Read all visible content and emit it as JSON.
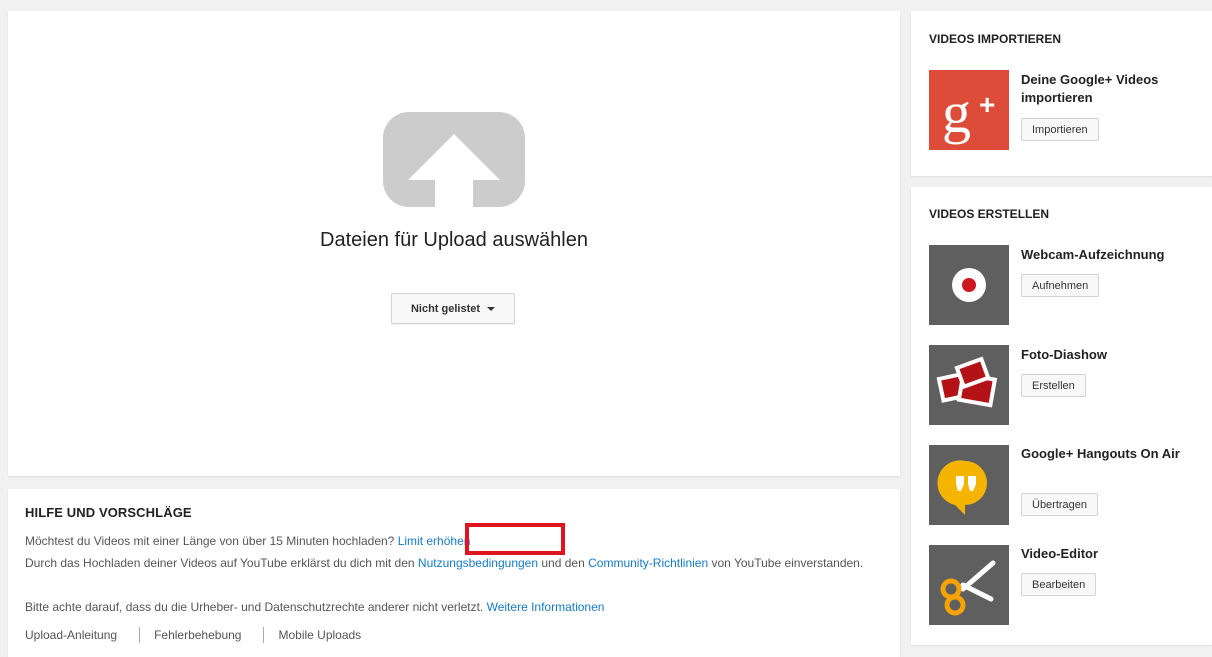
{
  "upload": {
    "title": "Dateien für Upload auswählen",
    "privacy_label": "Nicht gelistet"
  },
  "help": {
    "heading": "HILFE UND VORSCHLÄGE",
    "line1_text": "Möchtest du Videos mit einer Länge von über 15 Minuten hochladen?",
    "line1_link": "Limit erhöhen",
    "line2_prefix": "Durch das Hochladen deiner Videos auf YouTube erklärst du dich mit den",
    "line2_link1": "Nutzungsbedingungen",
    "line2_mid": "und den",
    "line2_link2": "Community-Richtlinien",
    "line2_suffix": "von YouTube einverstanden.",
    "line3_text": "Bitte achte darauf, dass du die Urheber- und Datenschutzrechte anderer nicht verletzt.",
    "line3_link": "Weitere Informationen",
    "links": [
      "Upload-Anleitung",
      "Fehlerbehebung",
      "Mobile Uploads"
    ]
  },
  "import_section": {
    "heading": "VIDEOS IMPORTIEREN",
    "item_title": "Deine Google+ Videos importieren",
    "button": "Importieren",
    "icon": "google-plus-icon"
  },
  "create_section": {
    "heading": "VIDEOS ERSTELLEN",
    "items": [
      {
        "title": "Webcam-Aufzeichnung",
        "button": "Aufnehmen",
        "icon": "webcam-record-icon"
      },
      {
        "title": "Foto-Diashow",
        "button": "Erstellen",
        "icon": "photo-slideshow-icon"
      },
      {
        "title": "Google+ Hangouts On Air",
        "button": "Übertragen",
        "icon": "hangouts-icon"
      },
      {
        "title": "Video-Editor",
        "button": "Bearbeiten",
        "icon": "video-editor-icon"
      }
    ]
  },
  "colors": {
    "link": "#167ac6",
    "highlight": "#e0141e",
    "google_plus_red": "#dd4b39",
    "tile_gray": "#5f5f5f",
    "upload_icon_gray": "#cccccc",
    "hangouts_yellow": "#f4b400"
  }
}
